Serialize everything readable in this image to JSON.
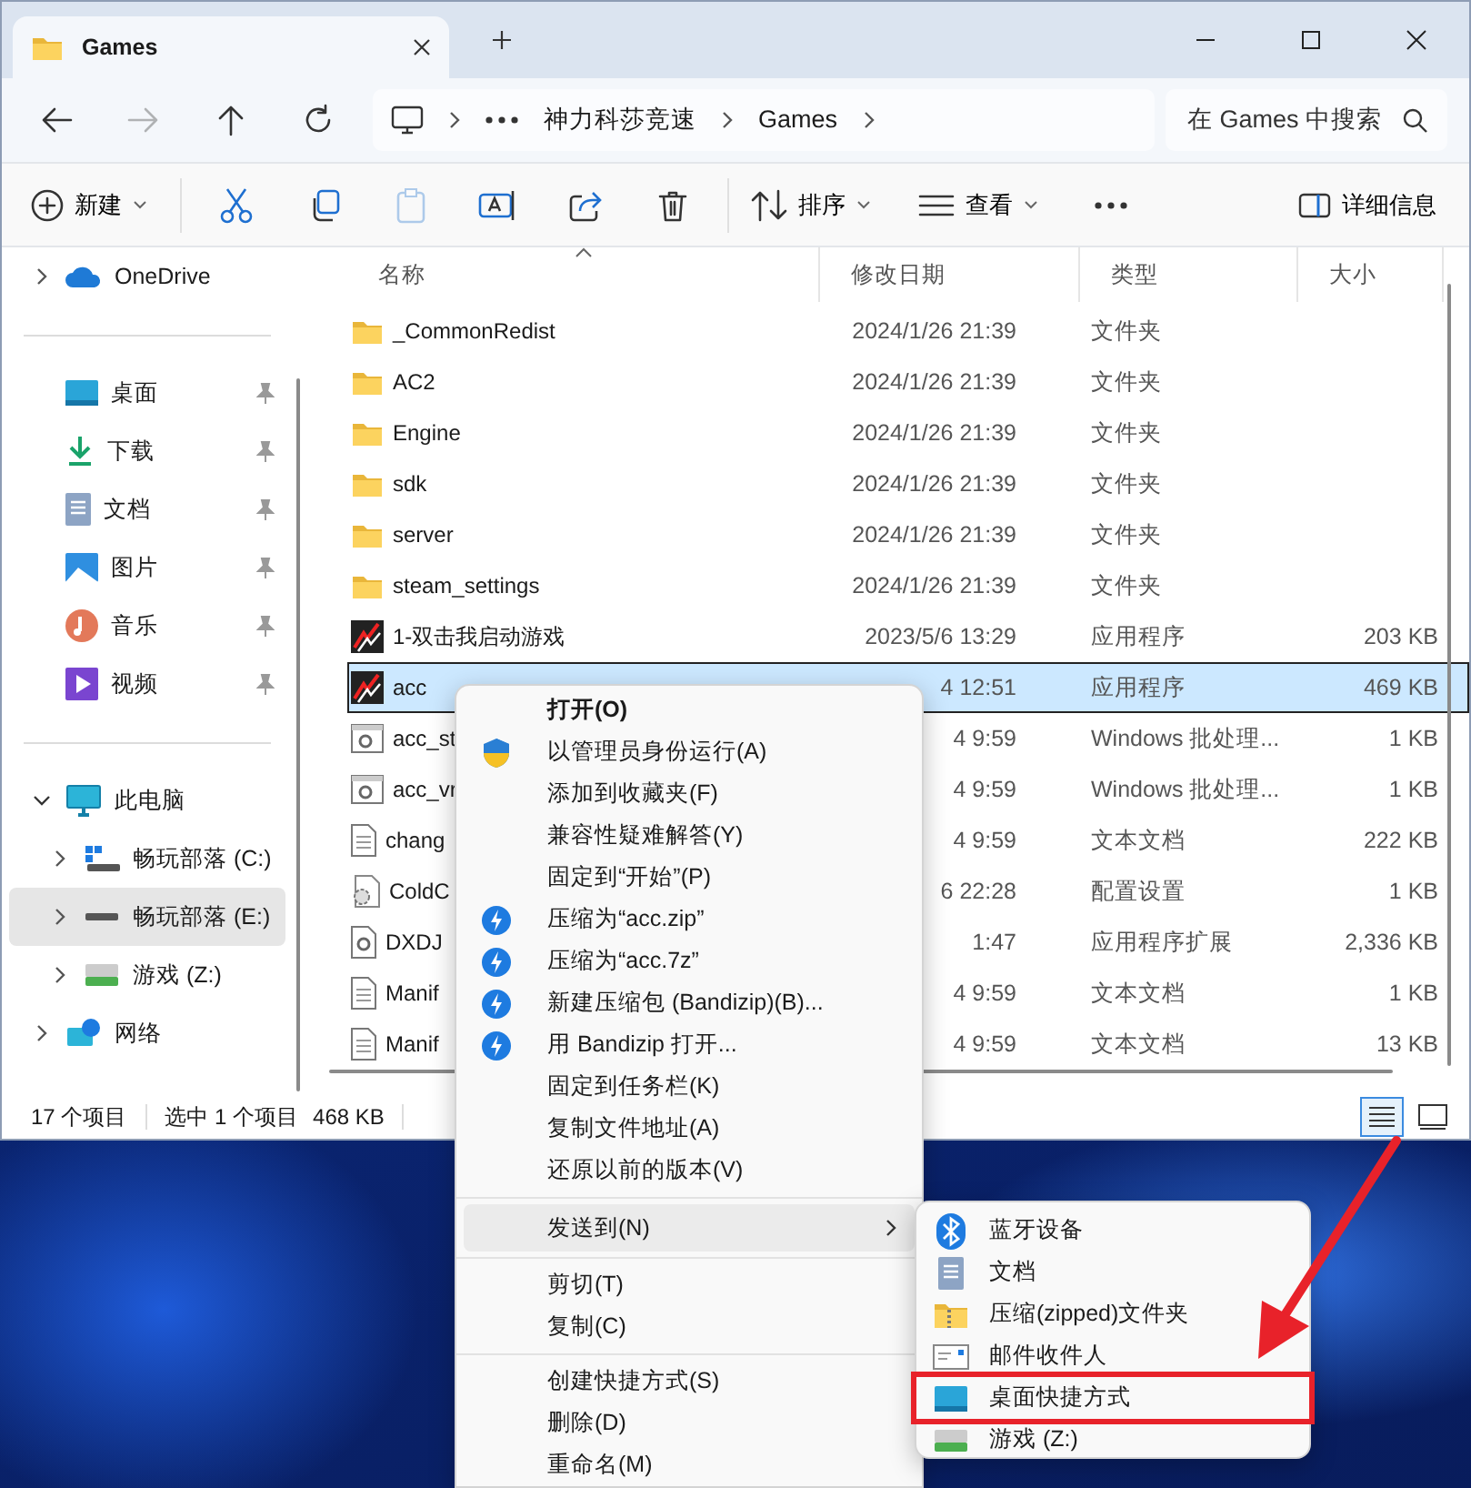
{
  "window": {
    "tab_title": "Games"
  },
  "nav_buttons": [
    {
      "kind": "back",
      "disabled": false
    },
    {
      "kind": "forward",
      "disabled": true
    },
    {
      "kind": "up",
      "disabled": false
    },
    {
      "kind": "refresh",
      "disabled": false
    }
  ],
  "breadcrumb": [
    "神力科莎竞速",
    "Games"
  ],
  "search": {
    "placeholder": "在 Games 中搜索"
  },
  "command_bar": [
    {
      "kind": "new",
      "label": "新建",
      "disabled": false
    },
    {
      "kind": "cut",
      "disabled": false
    },
    {
      "kind": "copy",
      "disabled": false
    },
    {
      "kind": "paste",
      "disabled": true
    },
    {
      "kind": "rename",
      "disabled": false
    },
    {
      "kind": "share",
      "disabled": false
    },
    {
      "kind": "delete",
      "disabled": false
    },
    {
      "kind": "sort",
      "label": "排序",
      "disabled": false
    },
    {
      "kind": "view",
      "label": "查看",
      "disabled": false
    },
    {
      "kind": "more",
      "disabled": false
    }
  ],
  "details_button": {
    "label": "详细信息"
  },
  "sidebar": {
    "top": [
      {
        "label": "OneDrive",
        "kind": "cloud",
        "expanded": false
      }
    ],
    "pinned": [
      {
        "label": "桌面",
        "kind": "desktop"
      },
      {
        "label": "下载",
        "kind": "download"
      },
      {
        "label": "文档",
        "kind": "documents"
      },
      {
        "label": "图片",
        "kind": "pictures"
      },
      {
        "label": "音乐",
        "kind": "music"
      },
      {
        "label": "视频",
        "kind": "video"
      }
    ],
    "tree": [
      {
        "label": "此电脑",
        "kind": "pc",
        "expanded": true,
        "selected": false,
        "children": [
          {
            "label": "畅玩部落 (C:)",
            "kind": "system-drive",
            "expanded": false,
            "selected": false
          },
          {
            "label": "畅玩部落 (E:)",
            "kind": "drive",
            "expanded": false,
            "selected": true
          },
          {
            "label": "游戏 (Z:)",
            "kind": "green-drive",
            "expanded": false,
            "selected": false
          }
        ]
      },
      {
        "label": "网络",
        "kind": "network",
        "expanded": false,
        "selected": false
      }
    ]
  },
  "table": {
    "columns": [
      {
        "label": "名称",
        "sorted": true
      },
      {
        "label": "修改日期",
        "sorted": false
      },
      {
        "label": "类型",
        "sorted": false
      },
      {
        "label": "大小",
        "sorted": false
      }
    ],
    "rows": [
      {
        "name": "_CommonRedist",
        "date": "2024/1/26 21:39",
        "type": "文件夹",
        "kind": "folder",
        "selected": false
      },
      {
        "name": "AC2",
        "date": "2024/1/26 21:39",
        "type": "文件夹",
        "kind": "folder",
        "selected": false
      },
      {
        "name": "Engine",
        "date": "2024/1/26 21:39",
        "type": "文件夹",
        "kind": "folder",
        "selected": false
      },
      {
        "name": "sdk",
        "date": "2024/1/26 21:39",
        "type": "文件夹",
        "kind": "folder",
        "selected": false
      },
      {
        "name": "server",
        "date": "2024/1/26 21:39",
        "type": "文件夹",
        "kind": "folder",
        "selected": false
      },
      {
        "name": "steam_settings",
        "date": "2024/1/26 21:39",
        "type": "文件夹",
        "kind": "folder",
        "selected": false
      },
      {
        "name": "1-双击我启动游戏",
        "date": "2023/5/6 13:29",
        "type": "应用程序",
        "size": "203 KB",
        "kind": "app",
        "selected": false
      },
      {
        "name": "acc",
        "date": "4 12:51",
        "type": "应用程序",
        "size": "469 KB",
        "kind": "app",
        "selected": true
      },
      {
        "name": "acc_st",
        "date": "4 9:59",
        "type": "Windows 批处理...",
        "size": "1 KB",
        "kind": "script",
        "selected": false
      },
      {
        "name": "acc_vr",
        "date": "4 9:59",
        "type": "Windows 批处理...",
        "size": "1 KB",
        "kind": "script",
        "selected": false
      },
      {
        "name": "chang",
        "date": "4 9:59",
        "type": "文本文档",
        "size": "222 KB",
        "kind": "text",
        "selected": false
      },
      {
        "name": "ColdC",
        "date": "6 22:28",
        "type": "配置设置",
        "size": "1 KB",
        "kind": "config",
        "selected": false
      },
      {
        "name": "DXDJ",
        "date": "1:47",
        "type": "应用程序扩展",
        "size": "2,336 KB",
        "kind": "extension",
        "selected": false
      },
      {
        "name": "Manif",
        "date": "4 9:59",
        "type": "文本文档",
        "size": "1 KB",
        "kind": "text",
        "selected": false
      },
      {
        "name": "Manif",
        "date": "4 9:59",
        "type": "文本文档",
        "size": "13 KB",
        "kind": "text",
        "selected": false
      }
    ]
  },
  "status_bar": {
    "count": "17 个项目",
    "selection": "选中 1 个项目",
    "selection_size": "468 KB",
    "views": [
      {
        "kind": "details",
        "selected": true
      },
      {
        "kind": "tiles",
        "selected": false
      }
    ]
  },
  "context_menu": {
    "groups": [
      [
        {
          "label": "打开(O)",
          "kind": "default",
          "selected": false
        },
        {
          "label": "以管理员身份运行(A)",
          "kind": "admin",
          "selected": false
        },
        {
          "label": "添加到收藏夹(F)",
          "kind": "plain",
          "selected": false
        },
        {
          "label": "兼容性疑难解答(Y)",
          "kind": "plain",
          "selected": false
        },
        {
          "label": "固定到“开始”(P)",
          "kind": "plain",
          "selected": false
        },
        {
          "label": "压缩为“acc.zip”",
          "kind": "archive",
          "selected": false
        },
        {
          "label": "压缩为“acc.7z”",
          "kind": "archive",
          "selected": false
        },
        {
          "label": "新建压缩包 (Bandizip)(B)...",
          "kind": "archive",
          "selected": false
        },
        {
          "label": "用 Bandizip 打开...",
          "kind": "archive",
          "selected": false
        },
        {
          "label": "固定到任务栏(K)",
          "kind": "plain",
          "selected": false
        },
        {
          "label": "复制文件地址(A)",
          "kind": "plain",
          "selected": false
        },
        {
          "label": "还原以前的版本(V)",
          "kind": "plain",
          "selected": false
        }
      ],
      [
        {
          "label": "发送到(N)",
          "kind": "submenu",
          "selected": true
        }
      ],
      [
        {
          "label": "剪切(T)",
          "kind": "plain",
          "selected": false
        },
        {
          "label": "复制(C)",
          "kind": "plain",
          "selected": false
        }
      ],
      [
        {
          "label": "创建快捷方式(S)",
          "kind": "plain",
          "selected": false
        },
        {
          "label": "删除(D)",
          "kind": "plain",
          "selected": false
        },
        {
          "label": "重命名(M)",
          "kind": "plain",
          "selected": false
        }
      ]
    ]
  },
  "send_to": {
    "items": [
      {
        "label": "蓝牙设备",
        "kind": "bluetooth",
        "annotated": false
      },
      {
        "label": "文档",
        "kind": "documents",
        "annotated": false
      },
      {
        "label": "压缩(zipped)文件夹",
        "kind": "zip",
        "annotated": false
      },
      {
        "label": "邮件收件人",
        "kind": "mail",
        "annotated": false
      },
      {
        "label": "桌面快捷方式",
        "kind": "desktop",
        "annotated": true
      },
      {
        "label": "游戏 (Z:)",
        "kind": "green-drive",
        "annotated": false
      }
    ]
  }
}
